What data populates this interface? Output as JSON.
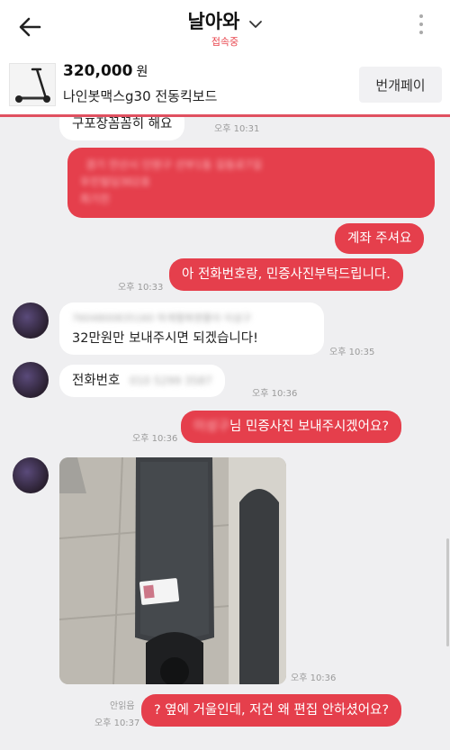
{
  "header": {
    "title": "날아와",
    "status": "접속중"
  },
  "product": {
    "price": "320,000",
    "price_unit": "원",
    "name": "나인봇맥스g30 전동킥보드",
    "pay_button": "번개페이"
  },
  "messages": {
    "m0_text": "구포장꼼꼼히 해요",
    "m0_time": "오후 10:31",
    "m1_blur_lines": [
      "경기 안산시 단원구 선부1동 길동로7길",
      "우진빌딩302호",
      "최기진"
    ],
    "m2_text": "계좌 주셔요",
    "m3_text": "아 전화번호랑, 민증사진부탁드립니다.",
    "m3_time": "오후 10:33",
    "m4_blur": "7604800835160 하계행복맨좋아 이성구",
    "m4_text": "32만원만 보내주시면 되겠습니다!",
    "m4_time": "오후 10:35",
    "m5_text": "전화번호",
    "m5_blur": "010 5299 3587",
    "m5_time": "오후 10:36",
    "m6_blur": "이성구",
    "m6_text": "님 민증사진 보내주시겠어요?",
    "m6_time": "오후 10:36",
    "m7_time": "오후 10:36",
    "m8_unread": "안읽음",
    "m8_time": "오후 10:37",
    "m8_text": "? 옆에 거울인데, 저건 왜 편집 안하셨어요?"
  },
  "colors": {
    "accent": "#e53f4c",
    "status": "#e8474f",
    "background": "#efeff1"
  },
  "icons": {
    "back": "arrow-left-icon",
    "title_dropdown": "chevron-down-icon",
    "more": "more-vertical-icon"
  }
}
